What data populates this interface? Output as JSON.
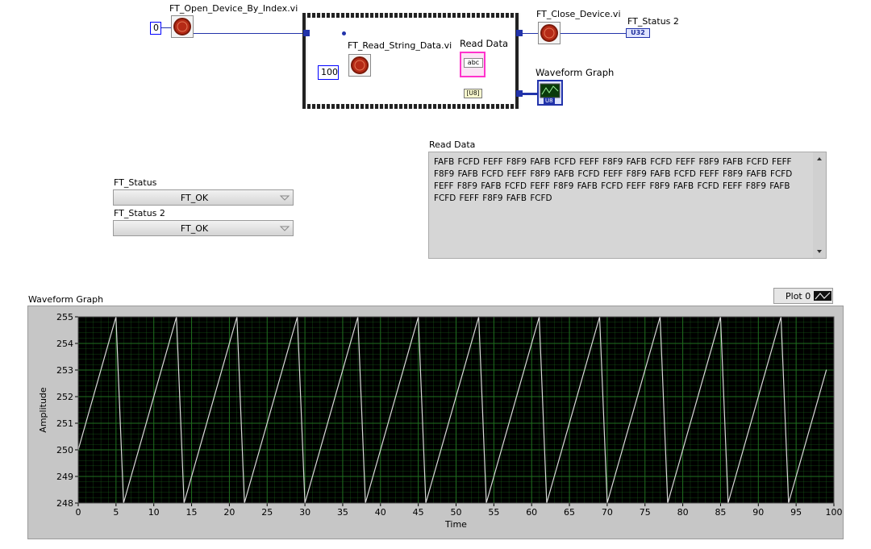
{
  "block_diagram": {
    "open_vi_label": "FT_Open_Device_By_Index.vi",
    "index_constant": "0",
    "read_vi_label": "FT_Read_String_Data.vi",
    "read_count_constant": "100",
    "read_data_terminal_label": "Read Data",
    "read_data_terminal_text": "abc",
    "u8_convert_text": "[U8]",
    "waveform_terminal_label": "Waveform Graph",
    "waveform_terminal_type": "U8",
    "close_vi_label": "FT_Close_Device.vi",
    "status2_terminal_label": "FT_Status 2",
    "status2_terminal_type": "U32"
  },
  "front_panel": {
    "status_label": "FT_Status",
    "status_value": "FT_OK",
    "status2_label": "FT_Status 2",
    "status2_value": "FT_OK",
    "read_data_label": "Read Data",
    "read_data_text": "FAFB FCFD FEFF F8F9 FAFB FCFD FEFF F8F9 FAFB FCFD FEFF F8F9 FAFB FCFD FEFF F8F9 FAFB FCFD FEFF F8F9 FAFB FCFD FEFF F8F9 FAFB FCFD FEFF F8F9 FAFB FCFD FEFF F8F9 FAFB FCFD FEFF F8F9 FAFB FCFD FEFF F8F9 FAFB FCFD FEFF F8F9 FAFB FCFD FEFF F8F9 FAFB FCFD"
  },
  "colors": {
    "plot_background": "#000000",
    "grid": "#1f6f1f",
    "trace": "#d8d8d8",
    "wire_numeric": "#2233aa",
    "wire_string": "#ff33cc"
  },
  "chart_data": {
    "type": "line",
    "title": "Waveform Graph",
    "xlabel": "Time",
    "ylabel": "Amplitude",
    "legend": [
      {
        "name": "Plot 0",
        "position": "top-right"
      }
    ],
    "xlim": [
      0,
      100
    ],
    "ylim": [
      248,
      255
    ],
    "xticks": [
      0,
      5,
      10,
      15,
      20,
      25,
      30,
      35,
      40,
      45,
      50,
      55,
      60,
      65,
      70,
      75,
      80,
      85,
      90,
      95,
      100
    ],
    "yticks": [
      248,
      249,
      250,
      251,
      252,
      253,
      254,
      255
    ],
    "grid": true,
    "series": [
      {
        "name": "Plot 0",
        "x": [
          0,
          5,
          6,
          13,
          14,
          21,
          22,
          29,
          30,
          37,
          38,
          45,
          46,
          53,
          54,
          61,
          62,
          69,
          70,
          77,
          78,
          85,
          86,
          93,
          94,
          99
        ],
        "y": [
          250,
          255,
          248,
          255,
          248,
          255,
          248,
          255,
          248,
          255,
          248,
          255,
          248,
          255,
          248,
          255,
          248,
          255,
          248,
          255,
          248,
          255,
          248,
          255,
          248,
          253
        ]
      }
    ]
  }
}
